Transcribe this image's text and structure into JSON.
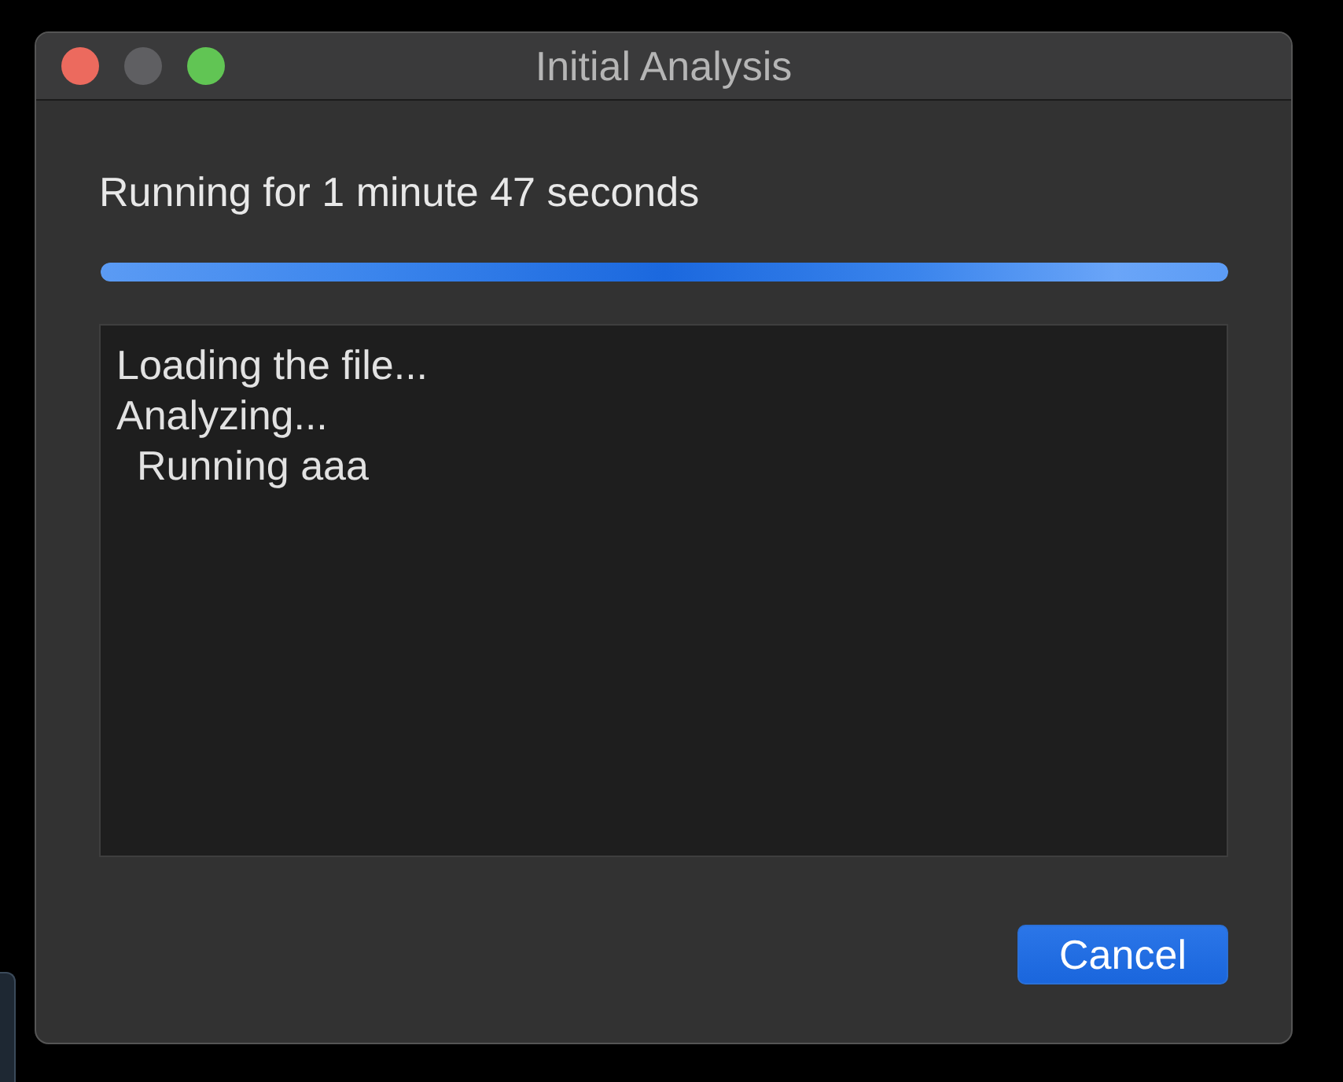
{
  "window": {
    "title": "Initial Analysis",
    "controls": [
      {
        "kind": "close"
      },
      {
        "kind": "minimize",
        "disabled": true
      },
      {
        "kind": "zoom"
      }
    ]
  },
  "status": {
    "text": "Running for 1 minute 47 seconds"
  },
  "progress": {
    "level": 1.0
  },
  "log": [
    {
      "text": "Loading the file..."
    },
    {
      "text": "Analyzing...",
      "children": [
        {
          "text": "Running aaa"
        }
      ]
    }
  ],
  "buttons": [
    {
      "label": "Cancel",
      "kind": "primary"
    }
  ]
}
